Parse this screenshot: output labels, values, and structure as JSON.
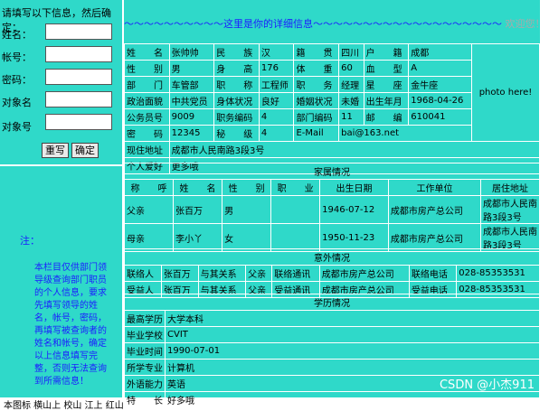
{
  "left": {
    "prompt": "请填写以下信息，然后确定：",
    "fields": [
      {
        "label": "姓名："
      },
      {
        "label": "帐号："
      },
      {
        "label": "密码："
      },
      {
        "label": "对象名"
      },
      {
        "label": "对象号"
      }
    ],
    "buttons": [
      "重写",
      "确定"
    ],
    "note_title": "注：",
    "note_body": "本栏目仅供部门领导级查询部门职员的个人信息，要求先填写领导的姓名，帐号，密码，再填写被查询者的姓名和帐号，确定以上信息填写完整，否则无法查询到所需信息！"
  },
  "marquee": {
    "text": "～～～～～～～～～～这里是你的详细信息～～～～～～～～～～～～～～～～～～～",
    "highlight": "这里是你的详细信息",
    "trailing": "欢迎您！"
  },
  "personal": {
    "rows": [
      [
        "姓　　名",
        "张帅帅",
        "民　　族",
        "汉",
        "籍　　贯",
        "四川",
        "户　　籍",
        "成都"
      ],
      [
        "性　　别",
        "男",
        "身　　高",
        "176",
        "体　　重",
        "60",
        "血　　型",
        "A"
      ],
      [
        "部　　门",
        "车管部",
        "职　　称",
        "工程师",
        "职　　务",
        "经理",
        "星　　座",
        "金牛座"
      ],
      [
        "政治面貌",
        "中共党员",
        "身体状况",
        "良好",
        "婚姻状况",
        "未婚",
        "出生年月",
        "1968-04-26"
      ],
      [
        "公务员号",
        "9009",
        "职务编码",
        "4",
        "部门编码",
        "11",
        "邮　　编",
        "610041"
      ],
      [
        "密　　码",
        "12345",
        "秘　　级",
        "4",
        "E-Mail",
        "bai@163.net"
      ]
    ],
    "photo": "photo here!",
    "address_label": "现住地址",
    "address": "成都市人民南路3段3号",
    "hobby_label": "个人爱好",
    "hobby": "更多哦"
  },
  "family": {
    "title": "家属情况",
    "headers": [
      "称　　呼",
      "姓　　名",
      "性　　别",
      "职　　业",
      "出生日期",
      "工作单位",
      "居住地址"
    ],
    "rows": [
      [
        "父亲",
        "张百万",
        "男",
        "",
        "1946-07-12",
        "成都市房产总公司",
        "成都市人民南路3段3号"
      ],
      [
        "母亲",
        "李小丫",
        "女",
        "",
        "1950-11-23",
        "成都市房产总公司",
        "成都市人民南路3段3号"
      ]
    ]
  },
  "emergency": {
    "title": "意外情况",
    "rows": [
      [
        "联络人",
        "张百万",
        "与其关系",
        "父亲",
        "联络通讯",
        "成都市房产总公司",
        "联络电话",
        "028-85353531"
      ],
      [
        "受益人",
        "张百万",
        "与其关系",
        "父亲",
        "受益通讯",
        "成都市房产总公司",
        "受益电话",
        "028-85353531"
      ]
    ]
  },
  "education": {
    "title": "学历情况",
    "rows": [
      [
        "最高学历",
        "大学本科"
      ],
      [
        "毕业学校",
        "CVIT"
      ],
      [
        "毕业时间",
        "1990-07-01"
      ],
      [
        "所学专业",
        "计算机"
      ],
      [
        "外语能力",
        "英语"
      ],
      [
        "特　　长",
        "好多哦"
      ]
    ]
  },
  "watermark": "CSDN @小杰911",
  "bottom_caption": "本图标 横山上 校山 江上 红山"
}
